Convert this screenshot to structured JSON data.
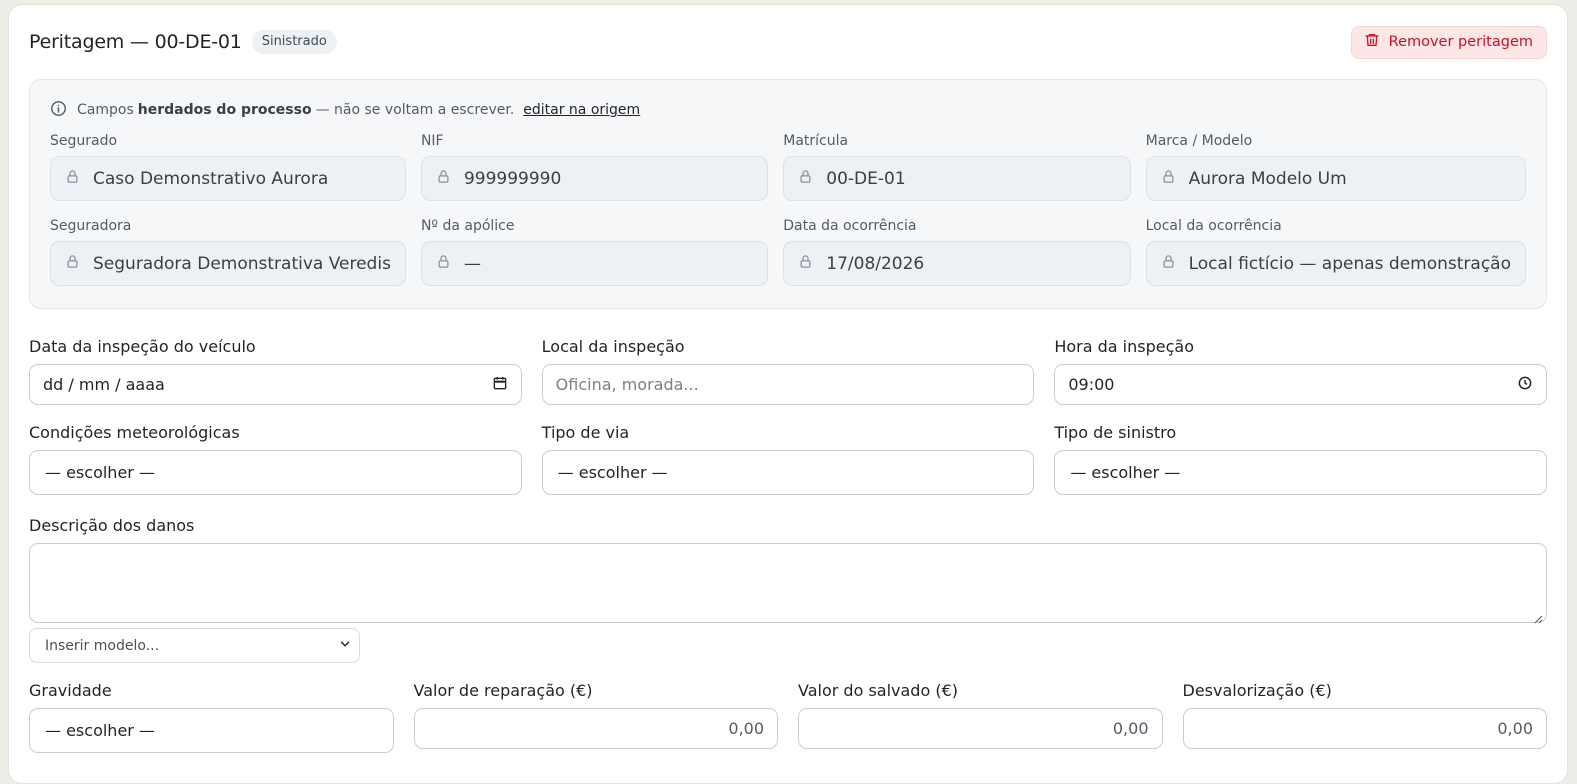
{
  "header": {
    "title": "Peritagem — 00-DE-01",
    "badge": "Sinistrado",
    "remove_label": "Remover peritagem"
  },
  "inherited": {
    "note_prefix": "Campos",
    "note_bold": "herdados do processo",
    "note_suffix": "— não se voltam a escrever.",
    "note_link": "editar na origem",
    "fields": [
      {
        "label": "Segurado",
        "value": "Caso Demonstrativo Aurora"
      },
      {
        "label": "NIF",
        "value": "999999990"
      },
      {
        "label": "Matrícula",
        "value": "00-DE-01"
      },
      {
        "label": "Marca / Modelo",
        "value": "Aurora Modelo Um"
      },
      {
        "label": "Seguradora",
        "value": "Seguradora Demonstrativa Veredis"
      },
      {
        "label": "Nº da apólice",
        "value": "—"
      },
      {
        "label": "Data da ocorrência",
        "value": "17/08/2026"
      },
      {
        "label": "Local da ocorrência",
        "value": "Local fictício — apenas demonstração"
      }
    ]
  },
  "form": {
    "inspection_date": {
      "label": "Data da inspeção do veículo",
      "value": "dd / mm / aaaa"
    },
    "inspection_place": {
      "label": "Local da inspeção",
      "placeholder": "Oficina, morada..."
    },
    "inspection_time": {
      "label": "Hora da inspeção",
      "value": "09:00"
    },
    "weather": {
      "label": "Condições meteorológicas",
      "value": "— escolher —"
    },
    "road_type": {
      "label": "Tipo de via",
      "value": "— escolher —"
    },
    "claim_type": {
      "label": "Tipo de sinistro",
      "value": "— escolher —"
    },
    "damage_desc": {
      "label": "Descrição dos danos"
    },
    "template_select": "Inserir modelo...",
    "severity": {
      "label": "Gravidade",
      "value": "— escolher —"
    },
    "repair_value": {
      "label": "Valor de reparação (€)",
      "value": "0,00"
    },
    "salvage_value": {
      "label": "Valor do salvado (€)",
      "value": "0,00"
    },
    "depreciation": {
      "label": "Desvalorização (€)",
      "value": "0,00"
    }
  },
  "colors": {
    "danger": "#c8102e",
    "danger_bg": "#fde6e6",
    "locked_bg": "#edf0f4"
  }
}
